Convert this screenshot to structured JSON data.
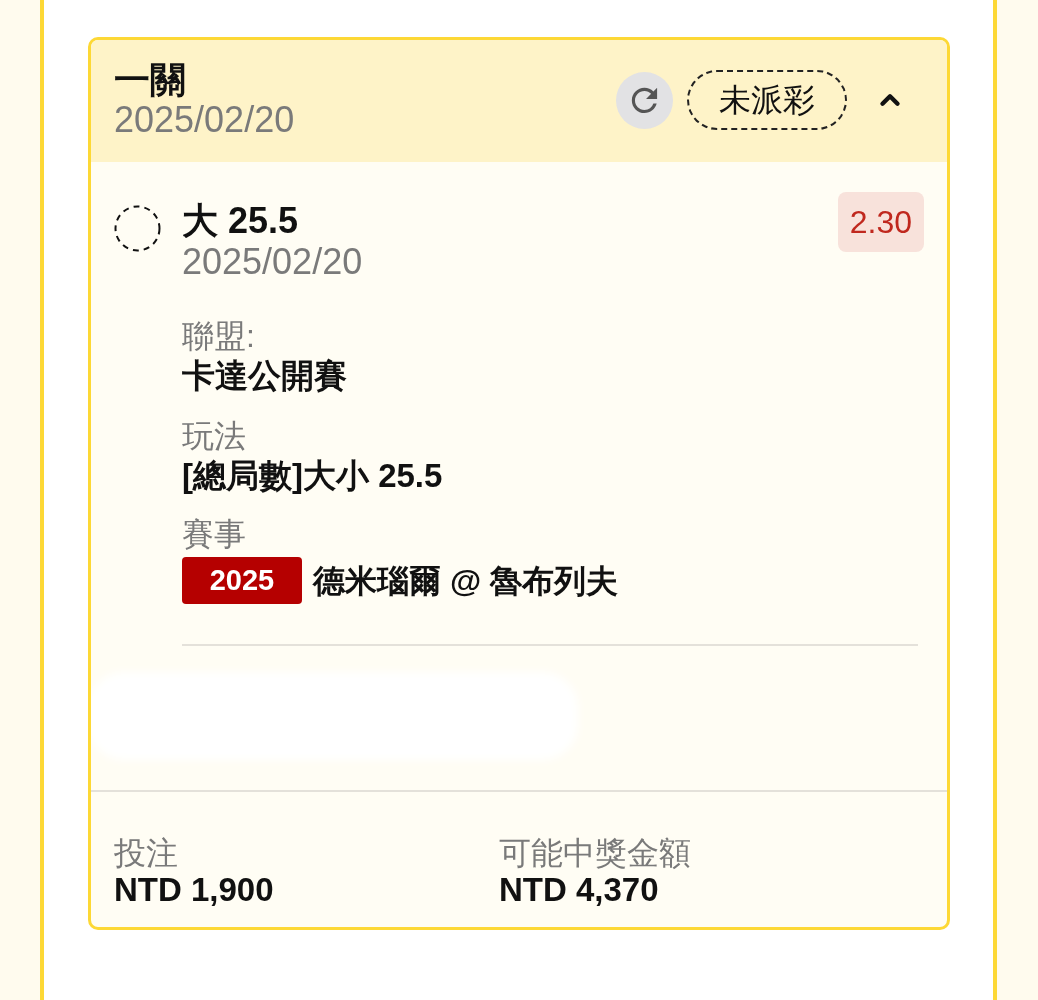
{
  "bet_card": {
    "title": "一關",
    "date": "2025/02/20",
    "status": "未派彩",
    "expanded": true,
    "selection": {
      "name": "大 25.5",
      "date": "2025/02/20",
      "odds": "2.30"
    },
    "details": [
      {
        "kind": "text",
        "label": "聯盟:",
        "value": "卡達公開賽"
      },
      {
        "kind": "text",
        "label": "玩法",
        "value": "[總局數]大小 25.5"
      },
      {
        "kind": "match",
        "label": "賽事",
        "tag": "2025",
        "value": "德米瑙爾 @ 魯布列夫"
      }
    ],
    "summary": [
      {
        "label": "投注",
        "value": "NTD 1,900"
      },
      {
        "label": "可能中獎金額",
        "value": "NTD 4,370"
      }
    ]
  }
}
